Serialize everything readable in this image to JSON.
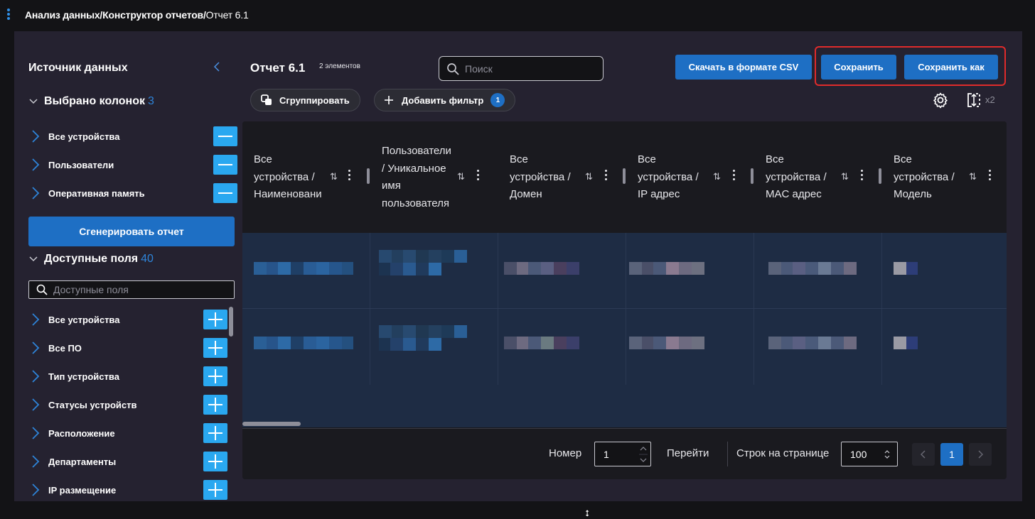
{
  "breadcrumb": {
    "path": "Анализ данных/Конструктор отчетов/",
    "current": "Отчет 6.1"
  },
  "left_panel": {
    "title": "Источник данных",
    "selected_section": {
      "label": "Выбрано колонок",
      "count": "3"
    },
    "selected_items": [
      "Все устройства",
      "Пользователи",
      "Оперативная память"
    ],
    "generate_label": "Сгенерировать отчет",
    "available_section": {
      "label": "Доступные поля",
      "count": "40"
    },
    "search_placeholder": "Доступные поля",
    "available_items": [
      "Все устройства",
      "Все ПО",
      "Тип устройства",
      "Статусы устройств",
      "Расположение",
      "Департаменты",
      "IP размещение"
    ]
  },
  "report": {
    "title": "Отчет 6.1",
    "count": "2 элементов",
    "search_placeholder": "Поиск",
    "csv_label": "Скачать в формате CSV",
    "save_label": "Сохранить",
    "save_as_label": "Сохранить как",
    "group_label": "Сгруппировать",
    "filter_label": "Добавить фильтр",
    "filter_count": "1",
    "density": "x2"
  },
  "table": {
    "columns": [
      "Все\nустройства /\nНаименовани",
      "Пользователи\n/ Уникальное\nимя\nпользователя",
      "Все\nустройства /\nДомен",
      "Все\nустройства /\nIP адрес",
      "Все\nустройства /\nMAC адрес",
      "Все\nустройства /\nМодель"
    ]
  },
  "pagination": {
    "page_label": "Номер",
    "page_value": "1",
    "go_label": "Перейти",
    "rows_label": "Строк на странице",
    "rows_value": "100",
    "current_page": "1"
  },
  "colors": {
    "accent": "#1e6fc4",
    "highlight": "#e02b2b",
    "add_button": "#2aa8f0"
  }
}
